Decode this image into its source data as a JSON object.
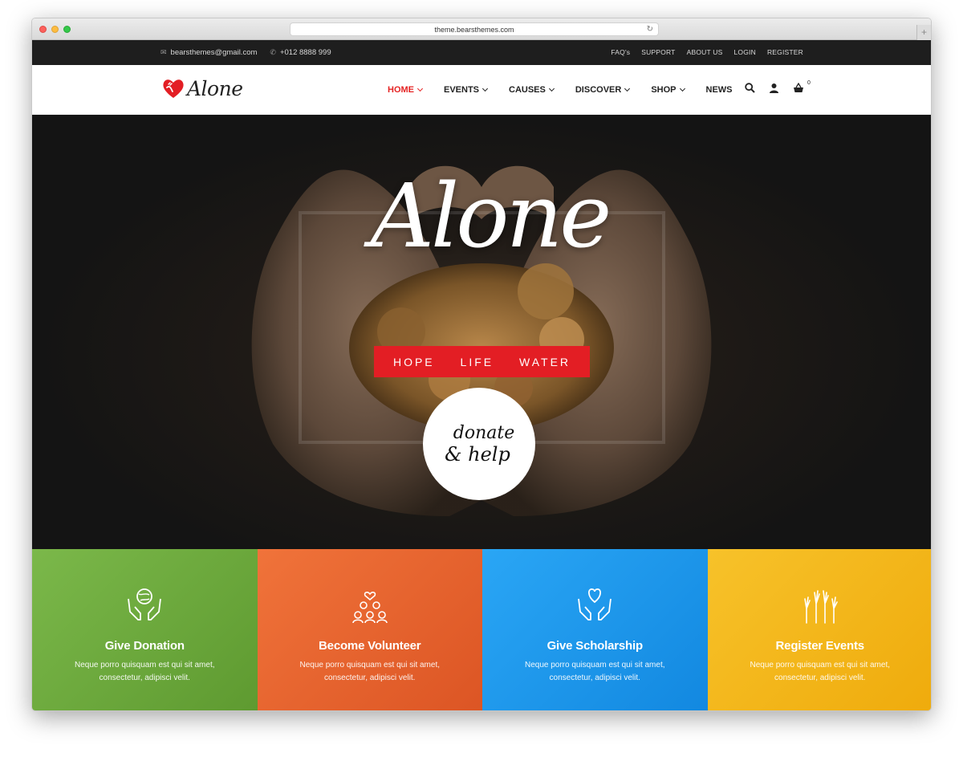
{
  "browser": {
    "url": "theme.bearsthemes.com",
    "newtab_label": "+"
  },
  "topbar": {
    "email": "bearsthemes@gmail.com",
    "phone": "+012 8888 999",
    "links": [
      "FAQ's",
      "SUPPORT",
      "ABOUT US",
      "LOGIN",
      "REGISTER"
    ]
  },
  "header": {
    "logo_text": "Alone",
    "nav": [
      {
        "label": "HOME",
        "active": true,
        "dropdown": true
      },
      {
        "label": "EVENTS",
        "active": false,
        "dropdown": true
      },
      {
        "label": "CAUSES",
        "active": false,
        "dropdown": true
      },
      {
        "label": "DISCOVER",
        "active": false,
        "dropdown": true
      },
      {
        "label": "SHOP",
        "active": false,
        "dropdown": true
      },
      {
        "label": "NEWS",
        "active": false,
        "dropdown": false
      }
    ],
    "cart_count": "0"
  },
  "hero": {
    "script_title": "Alone",
    "tagline": [
      "HOPE",
      "LIFE",
      "WATER"
    ],
    "donate_line1": "donate",
    "donate_line2": "& help"
  },
  "features": [
    {
      "title": "Give Donation",
      "desc": "Neque porro quisquam est qui sit amet, consectetur, adipisci velit.",
      "color": "#6aa83a",
      "icon": "globe-hands-icon"
    },
    {
      "title": "Become Volunteer",
      "desc": "Neque porro quisquam est qui sit amet, consectetur, adipisci velit.",
      "color": "#e9652e",
      "icon": "volunteer-group-icon"
    },
    {
      "title": "Give Scholarship",
      "desc": "Neque porro quisquam est qui sit amet, consectetur, adipisci velit.",
      "color": "#1e9bf0",
      "icon": "heart-hands-icon"
    },
    {
      "title": "Register Events",
      "desc": "Neque porro quisquam est qui sit amet, consectetur, adipisci velit.",
      "color": "#f1b617",
      "icon": "raised-hands-icon"
    }
  ],
  "colors": {
    "accent": "#e31e24",
    "topbar_bg": "#1e1e1e"
  }
}
